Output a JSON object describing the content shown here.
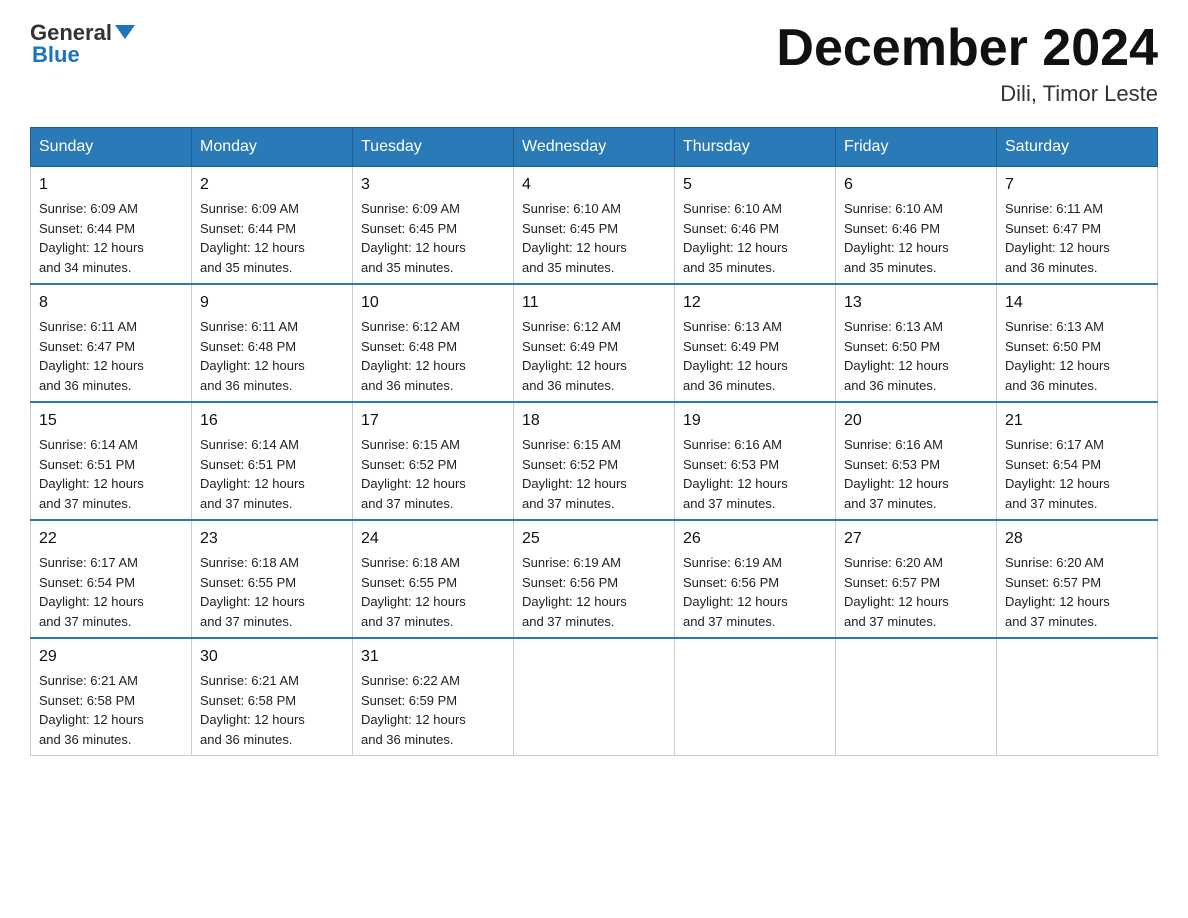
{
  "header": {
    "logo_general": "General",
    "logo_blue": "Blue",
    "month_title": "December 2024",
    "location": "Dili, Timor Leste"
  },
  "calendar": {
    "days_of_week": [
      "Sunday",
      "Monday",
      "Tuesday",
      "Wednesday",
      "Thursday",
      "Friday",
      "Saturday"
    ],
    "weeks": [
      [
        {
          "day": "1",
          "sunrise": "6:09 AM",
          "sunset": "6:44 PM",
          "daylight": "12 hours and 34 minutes."
        },
        {
          "day": "2",
          "sunrise": "6:09 AM",
          "sunset": "6:44 PM",
          "daylight": "12 hours and 35 minutes."
        },
        {
          "day": "3",
          "sunrise": "6:09 AM",
          "sunset": "6:45 PM",
          "daylight": "12 hours and 35 minutes."
        },
        {
          "day": "4",
          "sunrise": "6:10 AM",
          "sunset": "6:45 PM",
          "daylight": "12 hours and 35 minutes."
        },
        {
          "day": "5",
          "sunrise": "6:10 AM",
          "sunset": "6:46 PM",
          "daylight": "12 hours and 35 minutes."
        },
        {
          "day": "6",
          "sunrise": "6:10 AM",
          "sunset": "6:46 PM",
          "daylight": "12 hours and 35 minutes."
        },
        {
          "day": "7",
          "sunrise": "6:11 AM",
          "sunset": "6:47 PM",
          "daylight": "12 hours and 36 minutes."
        }
      ],
      [
        {
          "day": "8",
          "sunrise": "6:11 AM",
          "sunset": "6:47 PM",
          "daylight": "12 hours and 36 minutes."
        },
        {
          "day": "9",
          "sunrise": "6:11 AM",
          "sunset": "6:48 PM",
          "daylight": "12 hours and 36 minutes."
        },
        {
          "day": "10",
          "sunrise": "6:12 AM",
          "sunset": "6:48 PM",
          "daylight": "12 hours and 36 minutes."
        },
        {
          "day": "11",
          "sunrise": "6:12 AM",
          "sunset": "6:49 PM",
          "daylight": "12 hours and 36 minutes."
        },
        {
          "day": "12",
          "sunrise": "6:13 AM",
          "sunset": "6:49 PM",
          "daylight": "12 hours and 36 minutes."
        },
        {
          "day": "13",
          "sunrise": "6:13 AM",
          "sunset": "6:50 PM",
          "daylight": "12 hours and 36 minutes."
        },
        {
          "day": "14",
          "sunrise": "6:13 AM",
          "sunset": "6:50 PM",
          "daylight": "12 hours and 36 minutes."
        }
      ],
      [
        {
          "day": "15",
          "sunrise": "6:14 AM",
          "sunset": "6:51 PM",
          "daylight": "12 hours and 37 minutes."
        },
        {
          "day": "16",
          "sunrise": "6:14 AM",
          "sunset": "6:51 PM",
          "daylight": "12 hours and 37 minutes."
        },
        {
          "day": "17",
          "sunrise": "6:15 AM",
          "sunset": "6:52 PM",
          "daylight": "12 hours and 37 minutes."
        },
        {
          "day": "18",
          "sunrise": "6:15 AM",
          "sunset": "6:52 PM",
          "daylight": "12 hours and 37 minutes."
        },
        {
          "day": "19",
          "sunrise": "6:16 AM",
          "sunset": "6:53 PM",
          "daylight": "12 hours and 37 minutes."
        },
        {
          "day": "20",
          "sunrise": "6:16 AM",
          "sunset": "6:53 PM",
          "daylight": "12 hours and 37 minutes."
        },
        {
          "day": "21",
          "sunrise": "6:17 AM",
          "sunset": "6:54 PM",
          "daylight": "12 hours and 37 minutes."
        }
      ],
      [
        {
          "day": "22",
          "sunrise": "6:17 AM",
          "sunset": "6:54 PM",
          "daylight": "12 hours and 37 minutes."
        },
        {
          "day": "23",
          "sunrise": "6:18 AM",
          "sunset": "6:55 PM",
          "daylight": "12 hours and 37 minutes."
        },
        {
          "day": "24",
          "sunrise": "6:18 AM",
          "sunset": "6:55 PM",
          "daylight": "12 hours and 37 minutes."
        },
        {
          "day": "25",
          "sunrise": "6:19 AM",
          "sunset": "6:56 PM",
          "daylight": "12 hours and 37 minutes."
        },
        {
          "day": "26",
          "sunrise": "6:19 AM",
          "sunset": "6:56 PM",
          "daylight": "12 hours and 37 minutes."
        },
        {
          "day": "27",
          "sunrise": "6:20 AM",
          "sunset": "6:57 PM",
          "daylight": "12 hours and 37 minutes."
        },
        {
          "day": "28",
          "sunrise": "6:20 AM",
          "sunset": "6:57 PM",
          "daylight": "12 hours and 37 minutes."
        }
      ],
      [
        {
          "day": "29",
          "sunrise": "6:21 AM",
          "sunset": "6:58 PM",
          "daylight": "12 hours and 36 minutes."
        },
        {
          "day": "30",
          "sunrise": "6:21 AM",
          "sunset": "6:58 PM",
          "daylight": "12 hours and 36 minutes."
        },
        {
          "day": "31",
          "sunrise": "6:22 AM",
          "sunset": "6:59 PM",
          "daylight": "12 hours and 36 minutes."
        },
        null,
        null,
        null,
        null
      ]
    ],
    "labels": {
      "sunrise": "Sunrise:",
      "sunset": "Sunset:",
      "daylight": "Daylight: 12 hours"
    }
  }
}
